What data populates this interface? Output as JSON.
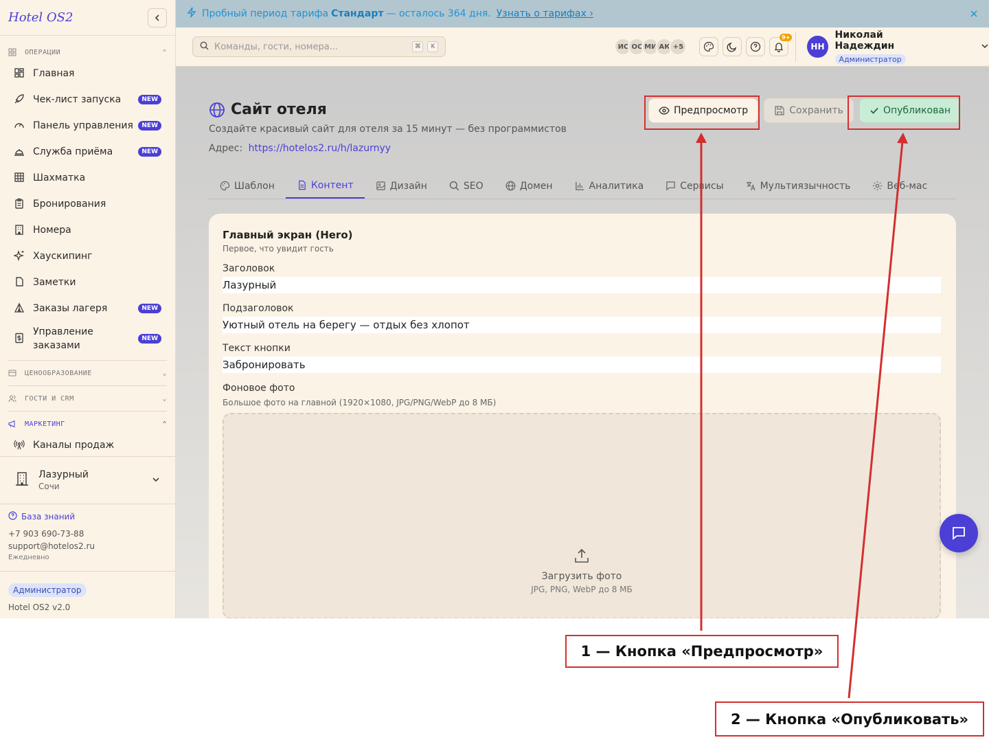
{
  "sidebar": {
    "logo": "Hotel OS2",
    "sections": {
      "operations": "ОПЕРАЦИИ",
      "pricing": "ЦЕНООБРАЗОВАНИЕ",
      "guests": "ГОСТИ И CRM",
      "marketing": "МАРКЕТИНГ"
    },
    "items": [
      {
        "label": "Главная"
      },
      {
        "label": "Чек-лист запуска",
        "badge": "NEW"
      },
      {
        "label": "Панель управления",
        "badge": "NEW"
      },
      {
        "label": "Служба приёма",
        "badge": "NEW"
      },
      {
        "label": "Шахматка"
      },
      {
        "label": "Бронирования"
      },
      {
        "label": "Номера"
      },
      {
        "label": "Хаускипинг"
      },
      {
        "label": "Заметки"
      },
      {
        "label": "Заказы лагеря",
        "badge": "NEW"
      },
      {
        "label": "Управление заказами",
        "badge": "NEW"
      },
      {
        "label": "Каналы продаж"
      }
    ],
    "hotel": {
      "name": "Лазурный",
      "city": "Сочи"
    },
    "support": {
      "kb": "База знаний",
      "phone": "+7 903 690-73-88",
      "email": "support@hotelos2.ru",
      "schedule": "Ежедневно"
    },
    "role": "Администратор",
    "version": "Hotel OS2 v2.0"
  },
  "banner": {
    "prefix": "Пробный период тарифа",
    "plan": "Стандарт",
    "suffix": "— осталось 364 дня.",
    "link": "Узнать о тарифах ›"
  },
  "topbar": {
    "search_placeholder": "Команды, гости, номера...",
    "kbd1": "⌘",
    "kbd2": "K",
    "avatars": [
      "ИС",
      "ОС",
      "МИ",
      "АК",
      "+5"
    ],
    "notif_count": "9+",
    "user": {
      "initials": "НН",
      "name": "Николай Надеждин",
      "role": "Администратор"
    }
  },
  "page": {
    "title": "Сайт отеля",
    "subtitle": "Создайте красивый сайт для отеля за 15 минут — без программистов",
    "address_label": "Адрес:",
    "address_url": "https://hotelos2.ru/h/lazurnyy",
    "actions": {
      "preview": "Предпросмотр",
      "save": "Сохранить",
      "published": "Опубликован"
    },
    "tabs": [
      "Шаблон",
      "Контент",
      "Дизайн",
      "SEO",
      "Домен",
      "Аналитика",
      "Сервисы",
      "Мультиязычность",
      "Веб-мас"
    ],
    "active_tab": "Контент"
  },
  "hero": {
    "title": "Главный экран (Hero)",
    "subtitle": "Первое, что увидит гость",
    "fields": [
      {
        "label": "Заголовок",
        "value": "Лазурный"
      },
      {
        "label": "Подзаголовок",
        "value": "Уютный отель на берегу — отдых без хлопот"
      },
      {
        "label": "Текст кнопки",
        "value": "Забронировать"
      }
    ],
    "photo": {
      "label": "Фоновое фото",
      "hint": "Большое фото на главной (1920×1080, JPG/PNG/WebP до 8 МБ)",
      "upload": "Загрузить фото",
      "upload_hint": "JPG, PNG, WebP до 8 МБ"
    }
  },
  "annotations": {
    "callout1": "1 — Кнопка «Предпросмотр»",
    "callout2": "2 — Кнопка «Опубликовать»"
  },
  "colors": {
    "accent": "#4b3fd6",
    "sidebar_bg": "#fbf3e6",
    "banner_bg": "#b2c6d0",
    "published_bg": "#c9ecd6",
    "annotation": "#d32f2f"
  }
}
